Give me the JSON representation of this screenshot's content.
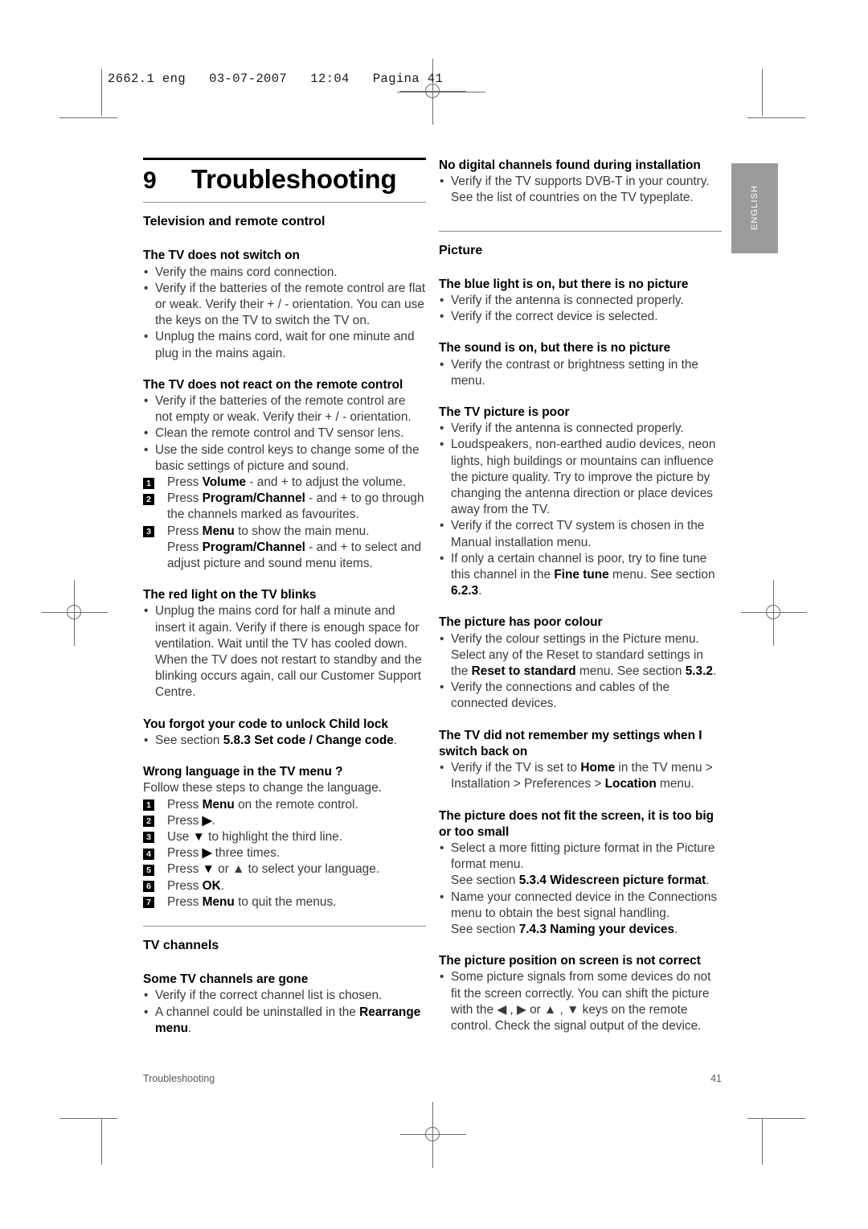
{
  "print_marks": {
    "slug": "2662.1 eng   03-07-2007   12:04   Pagina 41"
  },
  "thumb_tab": {
    "label": "ENGLISH"
  },
  "chapter": {
    "number": "9",
    "title": "Troubleshooting"
  },
  "left_column": {
    "section_title": "Television and remote control",
    "blocks": [
      {
        "heading": "The TV does not switch on",
        "bullets": [
          "Verify the mains cord connection.",
          "Verify if the batteries of the remote control are flat or weak. Verify their + / - orientation. You can use the keys on the TV to switch the TV on.",
          "Unplug the mains cord, wait for one minute and plug in the mains again."
        ]
      },
      {
        "heading": "The TV does not react on the remote control",
        "bullets": [
          "Verify if the batteries of the remote control are not empty or weak. Verify their + / - orientation.",
          "Clean the remote control and TV sensor lens.",
          "Use the side control keys to change some of the basic settings of picture and sound."
        ],
        "steps": [
          {
            "n": "1",
            "pre": "Press ",
            "bold": "Volume",
            "post": " - and + to adjust the volume."
          },
          {
            "n": "2",
            "pre": "Press ",
            "bold": "Program/Channel",
            "post": " - and + to go through the channels marked as favourites."
          },
          {
            "n": "3",
            "pre": "Press ",
            "bold": "Menu",
            "post": " to show the main menu.",
            "pre2": "Press ",
            "bold2": "Program/Channel",
            "post2": " - and + to select and adjust picture and sound menu items."
          }
        ]
      },
      {
        "heading": "The red light on the TV blinks",
        "bullets": [
          "Unplug the mains cord for half a minute and insert it again. Verify if there is enough space for ventilation. Wait until the TV has cooled down. When the TV does not restart to standby and the blinking occurs again, call our Customer Support Centre."
        ]
      },
      {
        "heading": "You forgot your code to unlock Child lock",
        "bullet_pre": "See section ",
        "bullet_bold": "5.8.3 Set code / Change code",
        "bullet_post": "."
      },
      {
        "heading": "Wrong language in the TV menu ?",
        "intro": "Follow these steps to change the language.",
        "steps": [
          {
            "n": "1",
            "pre": "Press ",
            "bold": "Menu",
            "post": " on the remote control."
          },
          {
            "n": "2",
            "pre": "Press ",
            "bold": "▶",
            "post": "."
          },
          {
            "n": "3",
            "pre": "Use ",
            "bold": "▼",
            "post": " to highlight the third line."
          },
          {
            "n": "4",
            "pre": "Press ",
            "bold": "▶",
            "post": " three times."
          },
          {
            "n": "5",
            "pre": "Press ",
            "bold": "▼",
            "post": " or ▲ to select your language."
          },
          {
            "n": "6",
            "pre": "Press ",
            "bold": "OK",
            "post": "."
          },
          {
            "n": "7",
            "pre": "Press ",
            "bold": "Menu",
            "post": " to quit the menus."
          }
        ]
      }
    ],
    "section_title_2": "TV channels",
    "blocks_2": [
      {
        "heading": "Some TV channels are gone",
        "bullets": [
          "Verify if the correct channel list is chosen."
        ],
        "bullet_rich_pre": "A channel could be uninstalled in the ",
        "bullet_rich_bold": "Rearrange menu",
        "bullet_rich_post": "."
      }
    ]
  },
  "right_column": {
    "blocks_top": [
      {
        "heading": "No digital channels found during installation",
        "bullets": [
          "Verify if the TV supports DVB-T in your country. See the list of countries on the TV typeplate."
        ]
      }
    ],
    "section_title": "Picture",
    "blocks": [
      {
        "heading": "The blue light is on, but there is no picture",
        "bullets": [
          "Verify if the antenna is connected properly.",
          "Verify if the correct device is selected."
        ]
      },
      {
        "heading": "The sound is on, but there is no picture",
        "bullets": [
          "Verify the contrast or brightness setting in the menu."
        ]
      },
      {
        "heading": "The TV picture is poor",
        "bullets": [
          "Verify if the antenna is connected properly.",
          "Loudspeakers, non-earthed audio devices, neon lights, high buildings or mountains can influence the picture quality. Try to improve the picture by changing the antenna direction or place devices away from the TV.",
          "Verify if the correct TV system is chosen in the Manual installation menu."
        ],
        "bullet_rich_pre": "If only a certain channel is poor, try to fine tune this channel in the ",
        "bullet_rich_bold": "Fine tune",
        "bullet_rich_mid": " menu. See section ",
        "bullet_rich_bold2": "6.2.3",
        "bullet_rich_post": "."
      },
      {
        "heading": "The picture has poor colour",
        "bullet_rich_pre": "Verify the colour settings in the Picture menu. Select any of the Reset to standard settings in the ",
        "bullet_rich_bold": "Reset to standard",
        "bullet_rich_mid": " menu. See section ",
        "bullet_rich_bold2": "5.3.2",
        "bullet_rich_post": ".",
        "bullets": [
          "Verify the connections and cables of the connected devices."
        ]
      },
      {
        "heading": "The TV did not remember my settings when I switch back on",
        "bullet_rich_pre": "Verify if the TV is set to ",
        "bullet_rich_bold": "Home",
        "bullet_rich_mid": " in the TV menu > Installation > Preferences > ",
        "bullet_rich_bold2": "Location",
        "bullet_rich_post": " menu."
      },
      {
        "heading": "The picture does not fit the screen, it is too big or too small",
        "b1_line1": "Select a more fitting picture format in the Picture format menu.",
        "b1_line2_pre": "See section ",
        "b1_line2_bold": "5.3.4 Widescreen picture format",
        "b1_line2_post": ".",
        "b2_line1": "Name your connected device in the Connections menu to obtain the best signal handling.",
        "b2_line2_pre": "See section ",
        "b2_line2_bold": "7.4.3 Naming your devices",
        "b2_line2_post": "."
      },
      {
        "heading": "The picture position on screen is not correct",
        "bullets": [
          "Some picture signals from some devices do not fit the screen correctly. You can shift the picture with the ◀ , ▶ or ▲ , ▼ keys on the remote control. Check the signal output of the device."
        ]
      }
    ]
  },
  "footer": {
    "left": "Troubleshooting",
    "right": "41"
  }
}
